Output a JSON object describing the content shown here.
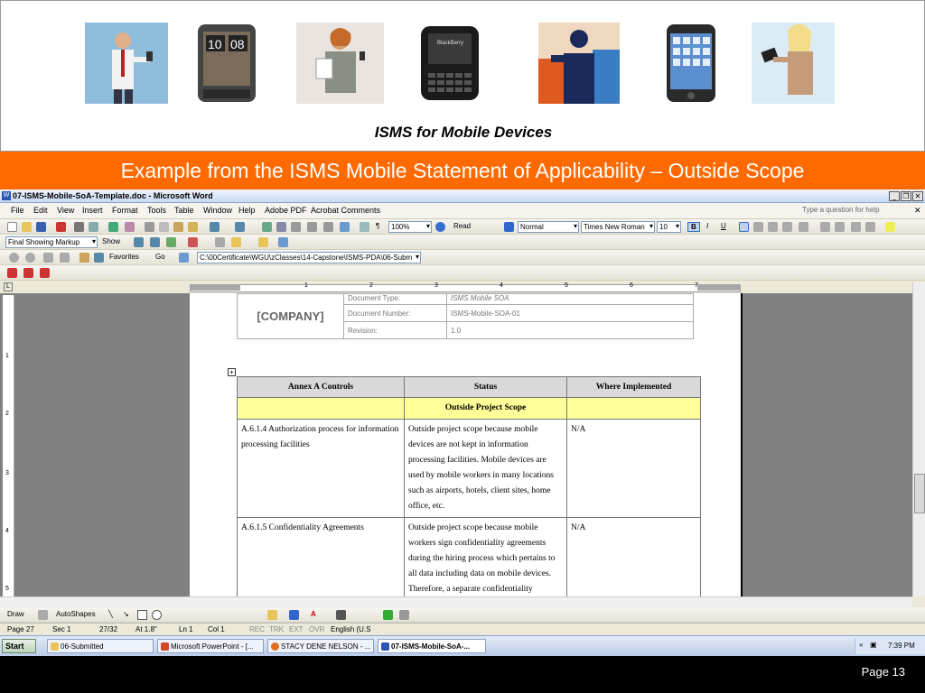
{
  "slide": {
    "subtitle": "ISMS for Mobile Devices",
    "title": "Example from the ISMS Mobile Statement of Applicability – Outside Scope",
    "page_label": "Page 13",
    "accent_color": "#ff6a00"
  },
  "banner_images": [
    "man-with-phone-icon",
    "smartphone-clock-icon",
    "woman-with-phone-icon",
    "blackberry-icon",
    "silhouette-man-phone-icon",
    "iphone-icon",
    "woman-with-tablet-icon"
  ],
  "word": {
    "window_title": "07-ISMS-Mobile-SoA-Template.doc - Microsoft Word",
    "menu": [
      "File",
      "Edit",
      "View",
      "Insert",
      "Format",
      "Tools",
      "Table",
      "Window",
      "Help",
      "Adobe PDF",
      "Acrobat Comments"
    ],
    "ask_placeholder": "Type a question for help",
    "zoom": "100%",
    "read_label": "Read",
    "style": "Normal",
    "font": "Times New Roman",
    "font_size": "10",
    "markup_view": "Final Showing Markup",
    "show_label": "Show",
    "favorites_label": "Favorites",
    "go_label": "Go",
    "address": "C:\\00Certificate\\WGU\\zClasses\\14-Capstone\\ISMS-PDA\\06-Subm",
    "draw_label": "Draw",
    "autoshapes_label": "AutoShapes",
    "ruler_numbers": [
      "1",
      "2",
      "3",
      "4",
      "5",
      "6",
      "7"
    ],
    "vruler_numbers": [
      "1",
      "2",
      "3",
      "4",
      "5"
    ]
  },
  "doc_header": {
    "company": "[COMPANY]",
    "rows": [
      {
        "label": "Document Type:",
        "value": "ISMS Mobile SOA"
      },
      {
        "label": "Document Number:",
        "value": "ISMS-Mobile-SOA-01"
      },
      {
        "label": "Revision:",
        "value": "1.0"
      }
    ]
  },
  "table": {
    "headers": [
      "Annex A Controls",
      "Status",
      "Where Implemented"
    ],
    "scope_label": "Outside Project Scope",
    "rows": [
      {
        "control": "A.6.1.4 Authorization process for information processing facilities",
        "status": "Outside project scope because mobile devices are not kept in information processing facilities.  Mobile devices are used by mobile workers in many locations such as airports, hotels, client sites, home office, etc.",
        "where": "N/A"
      },
      {
        "control": "A.6.1.5 Confidentiality Agreements",
        "status": "Outside project scope because mobile workers sign confidentiality agreements during the hiring process which pertains to all data including data on mobile devices.  Therefore, a separate confidentiality agreement is",
        "where": "N/A"
      }
    ]
  },
  "status_bar": {
    "page": "Page  27",
    "sec": "Sec  1",
    "pos": "27/32",
    "at": "At  1.8\"",
    "ln": "Ln  1",
    "col": "Col  1",
    "modes": [
      "REC",
      "TRK",
      "EXT",
      "OVR"
    ],
    "lang": "English (U.S"
  },
  "taskbar": {
    "start": "Start",
    "tasks": [
      "06-Submitted",
      "Microsoft PowerPoint - [...",
      "STACY DENE NELSON - ...",
      "07-ISMS-Mobile-SoA-..."
    ],
    "time": "7:39 PM"
  }
}
